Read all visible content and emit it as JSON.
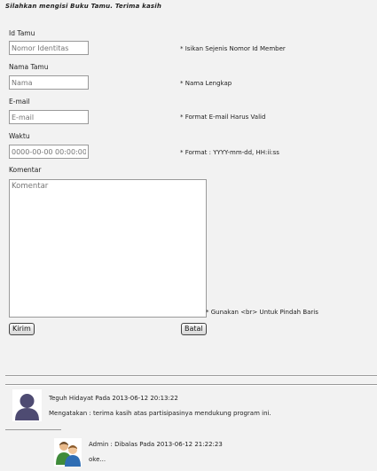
{
  "form": {
    "title": "Silahkan mengisi Buku Tamu. Terima kasih",
    "id": {
      "label": "Id Tamu",
      "placeholder": "Nomor Identitas",
      "hint": "* Isikan Sejenis Nomor Id Member"
    },
    "nama": {
      "label": "Nama Tamu",
      "placeholder": "Nama",
      "hint": "* Nama Lengkap"
    },
    "email": {
      "label": "E-mail",
      "placeholder": "E-mail",
      "hint": "* Format E-mail Harus Valid"
    },
    "waktu": {
      "label": "Waktu",
      "placeholder": "0000-00-00 00:00:00",
      "hint": "* Format : YYYY-mm-dd, HH:ii:ss"
    },
    "komentar": {
      "label": "Komentar",
      "placeholder": "Komentar",
      "hint": "* Gunakan <br> Untuk Pindah Baris"
    },
    "submit_label": "Kirim",
    "cancel_label": "Batal"
  },
  "comments": [
    {
      "author_line": "Teguh Hidayat Pada 2013-06-12 20:13:22",
      "text": "Mengatakan : terima kasih atas partisipasinya mendukung program ini.",
      "reply": {
        "author_line": "Admin : Dibalas Pada 2013-06-12 21:22:23",
        "text": "oke..."
      }
    }
  ]
}
